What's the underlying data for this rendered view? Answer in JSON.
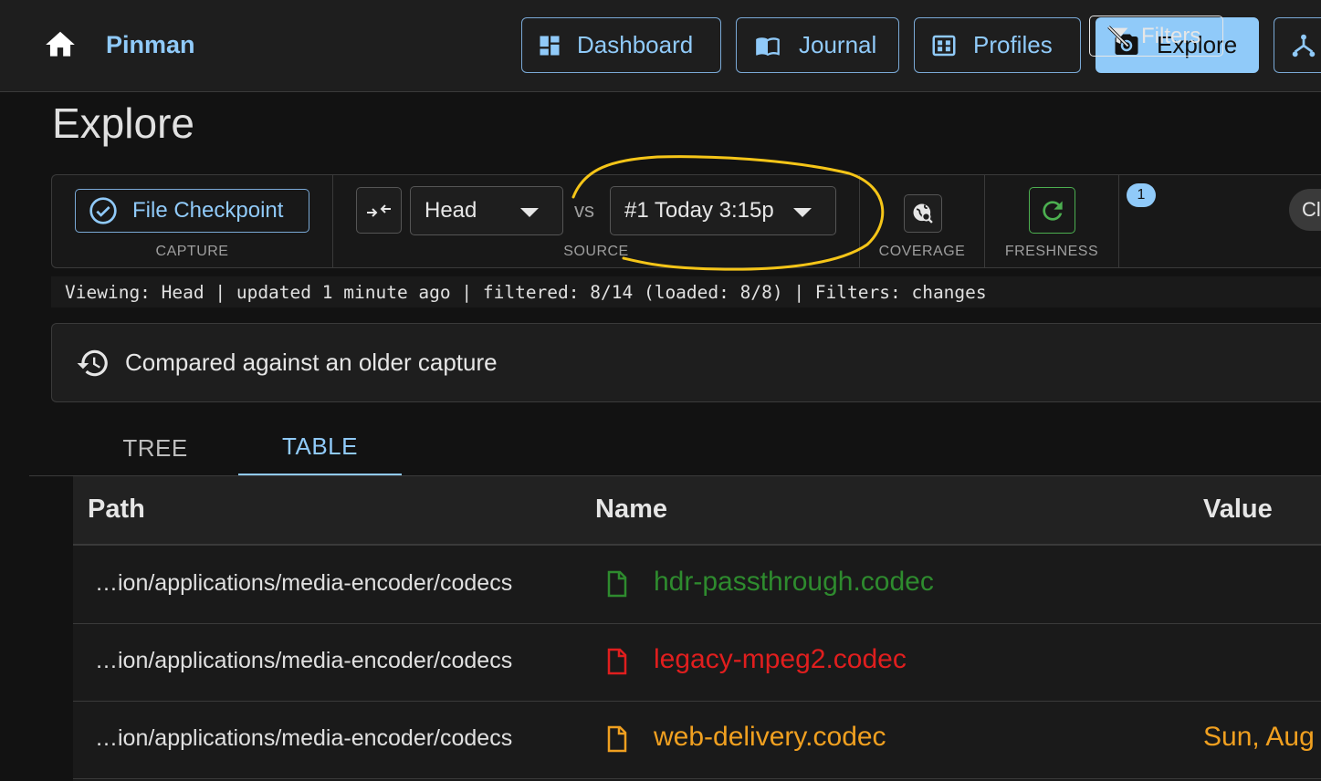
{
  "app": {
    "brand": "Pinman",
    "icon": "home-icon"
  },
  "nav": {
    "items": [
      {
        "label": "Dashboard",
        "icon": "dashboard-icon",
        "active": false
      },
      {
        "label": "Journal",
        "icon": "journal-icon",
        "active": false
      },
      {
        "label": "Profiles",
        "icon": "profiles-icon",
        "active": false
      },
      {
        "label": "Explore",
        "icon": "camera-icon",
        "active": true
      }
    ],
    "partial_icon": "fork-icon"
  },
  "page": {
    "title": "Explore"
  },
  "toolbar": {
    "capture": {
      "button_label": "File Checkpoint",
      "caption": "CAPTURE"
    },
    "source": {
      "left_value": "Head",
      "vs_label": "vs",
      "right_value": "#1 Today 3:15p",
      "caption": "SOURCE"
    },
    "coverage": {
      "caption": "COVERAGE"
    },
    "freshness": {
      "caption": "FRESHNESS"
    },
    "filters": {
      "label": "Filters",
      "badge_count": "1",
      "chip_partial": "Cl"
    }
  },
  "status": {
    "text": "Viewing: Head | updated 1 minute ago | filtered: 8/14 (loaded: 8/8) | Filters: changes"
  },
  "info": {
    "message": "Compared against an older capture",
    "icon": "history-icon"
  },
  "tabs": [
    {
      "label": "TREE",
      "active": false
    },
    {
      "label": "TABLE",
      "active": true
    }
  ],
  "table": {
    "columns": [
      "Path",
      "Name",
      "Value"
    ],
    "rows": [
      {
        "path": "…ion/applications/media-encoder/codecs",
        "name": "hdr-passthrough.codec",
        "value": "",
        "status": "added",
        "color": "#2e8b2e"
      },
      {
        "path": "…ion/applications/media-encoder/codecs",
        "name": "legacy-mpeg2.codec",
        "value": "",
        "status": "removed",
        "color": "#e01e1e"
      },
      {
        "path": "…ion/applications/media-encoder/codecs",
        "name": "web-delivery.codec",
        "value": "Sun, Aug",
        "status": "modified",
        "color": "#f0a020"
      }
    ]
  },
  "colors": {
    "accent": "#90caf9",
    "annotation": "#f5c518",
    "freshness": "#4caf50"
  }
}
